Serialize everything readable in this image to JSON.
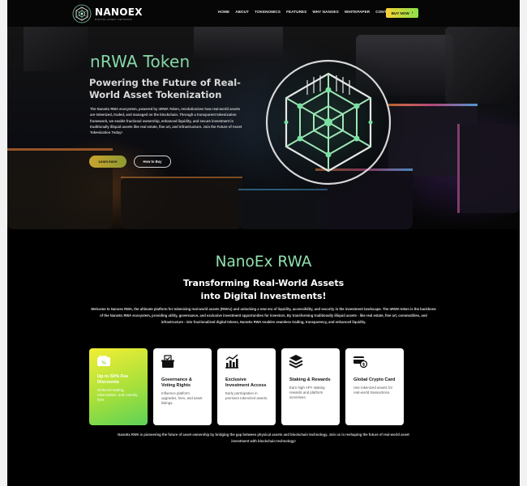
{
  "nav": {
    "brand": "NANOEX",
    "tagline": "DIGITAL  ASSET  NETWORK",
    "menu": [
      "HOME",
      "ABOUT",
      "TOKENOMICS",
      "FEATURES",
      "WHY NANOEX",
      "WHITEPAPER",
      "CONTACT"
    ],
    "buy_label": "BUY NOW",
    "buy_icon": "arrow-right-icon"
  },
  "hero": {
    "title": "nRWA Token",
    "subtitle": "Powering the Future of Real-World Asset Tokenization",
    "body": "The NanoEx RWA ecosystem, powered by nRWA Token, revolutionizes how real-world assets are tokenized, traded, and managed on the blockchain. Through a transparent tokenization framework, we enable fractional ownership, enhanced liquidity, and secure investment in traditionally illiquid assets like real estate, fine art, and infrastructure. Join the Future of Asset Tokenization Today!",
    "learn_label": "Learn more",
    "buy_label": "How to Buy"
  },
  "rwa": {
    "title": "NanoEx RWA",
    "subtitle": "Transforming Real-World Assets into Digital Investments!",
    "body": "Welcome to Nanoex RWA, the ultimate platform for tokenizing real-world assets (RWAs) and unlocking a new era of liquidity, accessibility, and security in the investment landscape. The nRWA token is the backbone of the NanoEx RWA ecosystem, providing utility, governance, and exclusive investment opportunities for investors. By transforming traditionally illiquid assets - like real estate, fine art, commodities, and infrastructure - into fractionalized digital tokens, NanoEx RWA enables seamless trading, transparency, and enhanced liquidity.",
    "cards": [
      {
        "icon": "discount-wallet-icon",
        "title": "Up to 50% Fee Discounts",
        "text": "Reduced trading, tokenization, and custody fees."
      },
      {
        "icon": "ballot-box-icon",
        "title": "Governance & Voting Rights",
        "text": "Influence platform upgrades, fees, and asset listings."
      },
      {
        "icon": "growth-chart-icon",
        "title": "Exclusive Investment Access",
        "text": "Early participation in premium tokenized assets."
      },
      {
        "icon": "stacked-coins-icon",
        "title": "Staking & Rewards",
        "text": "Earn high APY staking rewards and platform incentives."
      },
      {
        "icon": "credit-card-icon",
        "title": "Global Crypto Card",
        "text": "Use tokenized assets for real-world transactions."
      }
    ],
    "footer": "NanoEx RWA is pioneering the future of asset ownership by bridging the gap between physical assets and blockchain technology. Join us in reshaping the future of real-world asset investment with blockchain technology!"
  },
  "colors": {
    "accent_green": "#86d7a8",
    "buy_gradient_start": "#f7d234",
    "buy_gradient_end": "#8be04a"
  }
}
